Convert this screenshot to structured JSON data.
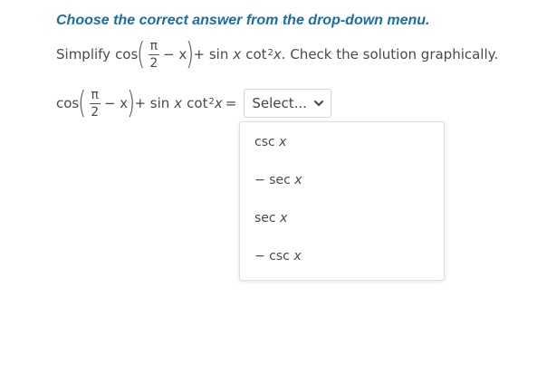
{
  "instruction": "Choose the correct answer from the drop-down menu.",
  "prompt": {
    "lead": "Simplify",
    "cos": "cos",
    "pi": "π",
    "two": "2",
    "minus_x": "− x",
    "plus_sin": "+ sin",
    "x1": "x",
    "cot": "cot",
    "sq": "2",
    "x2": "x",
    "tail": ". Check the solution graphically."
  },
  "equation": {
    "cos": "cos",
    "pi": "π",
    "two": "2",
    "minus_x": "− x",
    "plus_sin": "+ sin",
    "x1": "x",
    "cot": "cot",
    "sq": "2",
    "x2": "x",
    "equals": "="
  },
  "select": {
    "placeholder": "Select..."
  },
  "options": [
    {
      "fn": "csc",
      "var": "x"
    },
    {
      "fn": "− sec",
      "var": "x"
    },
    {
      "fn": "sec",
      "var": "x"
    },
    {
      "fn": "− csc",
      "var": "x"
    }
  ],
  "colors": {
    "instruction": "#1a6fa0",
    "text": "#4a4a4a",
    "border": "#dedede"
  }
}
